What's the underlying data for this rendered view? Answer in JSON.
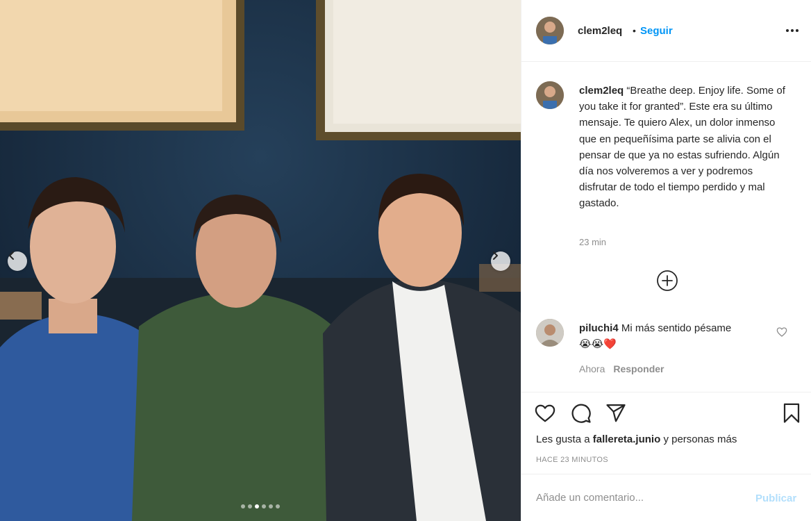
{
  "post": {
    "username": "clem2leq",
    "separator": "•",
    "follow_label": "Seguir",
    "more_icon": "more-horizontal-icon",
    "caption": {
      "username": "clem2leq",
      "text": "“Breathe deep. Enjoy life. Some of you take it for granted”. Este era su último mensaje. Te quiero Alex, un dolor inmenso que en pequeñísima parte se alivia con el pensar de que ya no estas sufriendo. Algún día nos volveremos a ver y podremos disfrutar de todo el tiempo perdido y mal gastado.",
      "time": "23 min"
    },
    "add_icon": "plus-circle-icon",
    "comments": [
      {
        "username": "piluchi4",
        "text": "Mi más sentido pésame",
        "emoji": "😭😭❤️",
        "time": "Ahora",
        "reply_label": "Responder"
      }
    ],
    "likes": {
      "prefix": "Les gusta a",
      "user": "fallereta.junio",
      "suffix": "y personas más"
    },
    "timestamp": "HACE 23 MINUTOS",
    "comment_placeholder": "Añade un comentario...",
    "publish_label": "Publicar",
    "carousel": {
      "total": 6,
      "active_index": 2
    }
  },
  "colors": {
    "link": "#0095f6",
    "publish_disabled": "#b2dffc",
    "muted": "#8e8e8e",
    "text": "#262626"
  }
}
